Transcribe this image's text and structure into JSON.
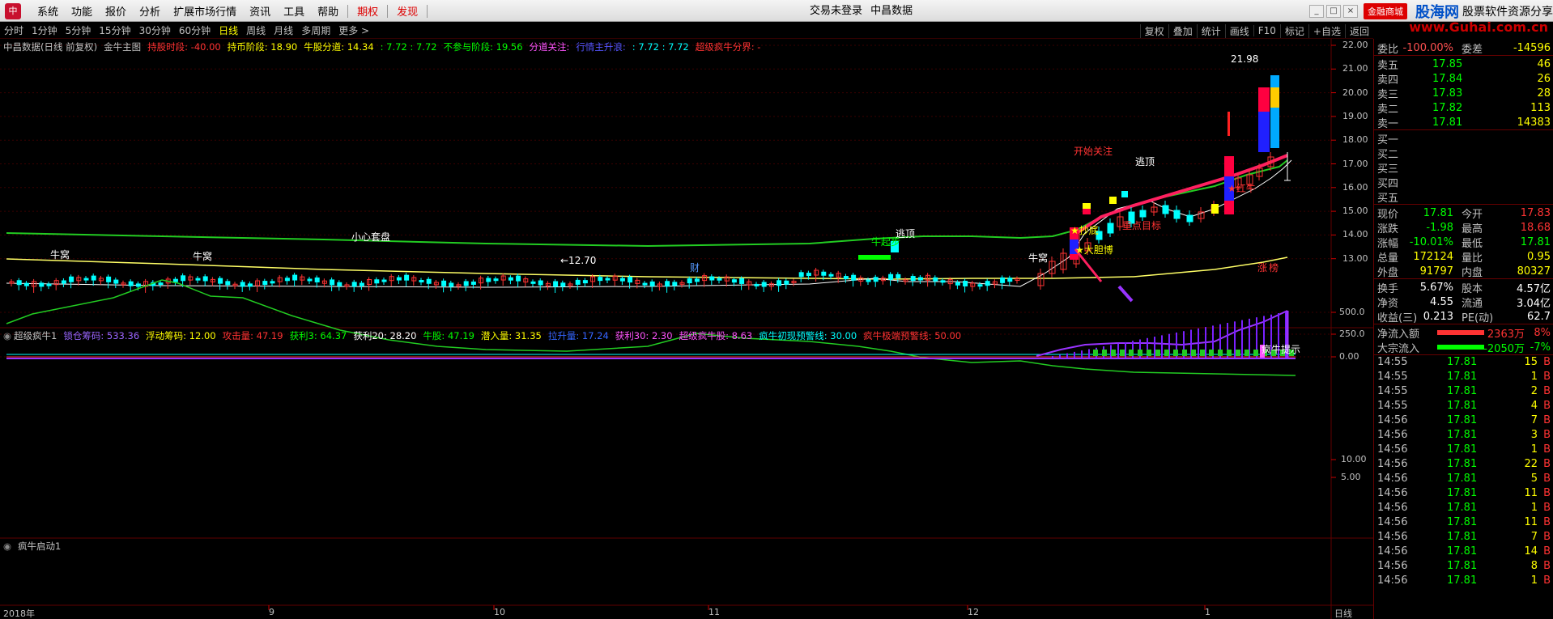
{
  "menubar": {
    "items": [
      "系统",
      "功能",
      "报价",
      "分析",
      "扩展市场行情",
      "资讯",
      "工具",
      "帮助"
    ],
    "special": [
      "期权",
      "发现"
    ],
    "center": [
      "交易未登录",
      "中昌数据"
    ],
    "mall": "金融商城",
    "brand": "股海网",
    "brand2": "股票软件资源分享",
    "brand_url": "www.Guhai.com.cn"
  },
  "toolbar": {
    "timeframes": [
      "分时",
      "1分钟",
      "5分钟",
      "15分钟",
      "30分钟",
      "60分钟",
      "日线",
      "周线",
      "月线",
      "多周期",
      "更多 >"
    ],
    "active": "日线",
    "right": [
      "复权",
      "叠加",
      "统计",
      "画线",
      "F10",
      "标记",
      "+自选",
      "返回"
    ]
  },
  "main_chart": {
    "title_items": [
      {
        "t": "中昌数据(日线 前复权)",
        "c": "#c0c0c0"
      },
      {
        "t": "金牛主图",
        "c": "#c0c0c0"
      },
      {
        "t": "持股时段: -40.00",
        "c": "#ff3333"
      },
      {
        "t": "持币阶段: 18.90",
        "c": "#ffff00"
      },
      {
        "t": "牛股分道: 14.34",
        "c": "#ffff00"
      },
      {
        "t": ": 7.72 : 7.72",
        "c": "#00ff00"
      },
      {
        "t": "不参与阶段: 19.56",
        "c": "#00ff00"
      },
      {
        "t": "分道关注:",
        "c": "#ff55ff"
      },
      {
        "t": "行情主升浪:",
        "c": "#5555ff"
      },
      {
        "t": ": 7.72 : 7.72",
        "c": "#00ffff"
      },
      {
        "t": "超级疯牛分界: -",
        "c": "#ff3333"
      }
    ],
    "y_ticks": [
      "22.00",
      "21.00",
      "20.00",
      "19.00",
      "18.00",
      "17.00",
      "16.00",
      "15.00",
      "14.00",
      "13.00"
    ],
    "annotations": [
      {
        "t": "21.98",
        "c": "#ffffff"
      },
      {
        "t": "开始关注",
        "c": "#ff3333"
      },
      {
        "t": "逃顶",
        "c": "#ffffff"
      },
      {
        "t": "★红牛",
        "c": "#ff3333"
      },
      {
        "t": "重点目标",
        "c": "#ff3333"
      },
      {
        "t": "★抄底",
        "c": "#ffff00"
      },
      {
        "t": "★大胆博",
        "c": "#ffff00"
      },
      {
        "t": "小心套盘",
        "c": "#ffffff"
      },
      {
        "t": "逃顶",
        "c": "#ffffff"
      },
      {
        "t": "牛起步",
        "c": "#00ff00"
      },
      {
        "t": "牛窝",
        "c": "#ffffff"
      },
      {
        "t": "牛窝",
        "c": "#ffffff"
      },
      {
        "t": "牛窝",
        "c": "#ffffff"
      },
      {
        "t": "←12.70",
        "c": "#ffffff"
      },
      {
        "t": "财",
        "c": "#5599ff"
      },
      {
        "t": "涨",
        "c": "#ff3333"
      },
      {
        "t": "榜",
        "c": "#ff3333"
      }
    ]
  },
  "sub_chart1": {
    "title_items": [
      {
        "t": "超级疯牛1",
        "c": "#c0c0c0"
      },
      {
        "t": "锁仓筹码: 533.36",
        "c": "#9966ff"
      },
      {
        "t": "浮动筹码: 12.00",
        "c": "#ffff00"
      },
      {
        "t": "攻击量: 47.19",
        "c": "#ff3333"
      },
      {
        "t": "获利3: 64.37",
        "c": "#00ff00"
      },
      {
        "t": "获利20: 28.20",
        "c": "#ffffff"
      },
      {
        "t": "牛股: 47.19",
        "c": "#00ff00"
      },
      {
        "t": "潜入量: 31.35",
        "c": "#ffff00"
      },
      {
        "t": "拉升量: 17.24",
        "c": "#3366ff"
      },
      {
        "t": "获利30: 2.30",
        "c": "#ff55ff"
      },
      {
        "t": "超级疯牛股: 8.63",
        "c": "#ff55ff"
      },
      {
        "t": "疯牛初现预警线: 30.00",
        "c": "#00ffff"
      },
      {
        "t": "疯牛极端预警线: 50.00",
        "c": "#ff3333"
      }
    ],
    "y_ticks": [
      "500.0",
      "250.0",
      "0.00"
    ],
    "annotation": "疯牛提示"
  },
  "sub_chart2": {
    "title": "疯牛启动1",
    "y_ticks": [
      "10.00",
      "5.00"
    ]
  },
  "x_axis": [
    "2018年",
    "9",
    "10",
    "11",
    "12",
    "1"
  ],
  "x_period": "日线",
  "quote": {
    "header": [
      {
        "l": "委比",
        "v1": "-100.00%",
        "l2": "委差",
        "v2": "-14596"
      }
    ],
    "sells": [
      {
        "l": "卖五",
        "p": "17.85",
        "n": "46"
      },
      {
        "l": "卖四",
        "p": "17.84",
        "n": "26"
      },
      {
        "l": "卖三",
        "p": "17.83",
        "n": "28"
      },
      {
        "l": "卖二",
        "p": "17.82",
        "n": "113"
      },
      {
        "l": "卖一",
        "p": "17.81",
        "n": "14383"
      }
    ],
    "buys": [
      "买一",
      "买二",
      "买三",
      "买四",
      "买五"
    ],
    "stats": [
      {
        "l": "现价",
        "v1": "17.81",
        "l2": "今开",
        "v2": "17.83"
      },
      {
        "l": "涨跌",
        "v1": "-1.98",
        "l2": "最高",
        "v2": "18.68"
      },
      {
        "l": "涨幅",
        "v1": "-10.01%",
        "l2": "最低",
        "v2": "17.81"
      },
      {
        "l": "总量",
        "v1": "172124",
        "l2": "量比",
        "v2": "0.95"
      },
      {
        "l": "外盘",
        "v1": "91797",
        "l2": "内盘",
        "v2": "80327"
      }
    ],
    "stats2": [
      {
        "l": "换手",
        "v1": "5.67%",
        "l2": "股本",
        "v2": "4.57亿"
      },
      {
        "l": "净资",
        "v1": "4.55",
        "l2": "流通",
        "v2": "3.04亿"
      },
      {
        "l": "收益(三)",
        "v1": "0.213",
        "l2": "PE(动)",
        "v2": "62.7"
      }
    ],
    "flows": [
      {
        "l": "净流入额",
        "v": "2363万",
        "p": "8%",
        "c": "#ff3333"
      },
      {
        "l": "大宗流入",
        "v": "-2050万",
        "p": "-7%",
        "c": "#00ff00"
      }
    ],
    "ticks": [
      {
        "t": "14:55",
        "p": "17.81",
        "n": "15",
        "s": "B"
      },
      {
        "t": "14:55",
        "p": "17.81",
        "n": "1",
        "s": "B"
      },
      {
        "t": "14:55",
        "p": "17.81",
        "n": "2",
        "s": "B"
      },
      {
        "t": "14:55",
        "p": "17.81",
        "n": "4",
        "s": "B"
      },
      {
        "t": "14:56",
        "p": "17.81",
        "n": "7",
        "s": "B"
      },
      {
        "t": "14:56",
        "p": "17.81",
        "n": "3",
        "s": "B"
      },
      {
        "t": "14:56",
        "p": "17.81",
        "n": "1",
        "s": "B"
      },
      {
        "t": "14:56",
        "p": "17.81",
        "n": "22",
        "s": "B"
      },
      {
        "t": "14:56",
        "p": "17.81",
        "n": "5",
        "s": "B"
      },
      {
        "t": "14:56",
        "p": "17.81",
        "n": "11",
        "s": "B"
      },
      {
        "t": "14:56",
        "p": "17.81",
        "n": "1",
        "s": "B"
      },
      {
        "t": "14:56",
        "p": "17.81",
        "n": "11",
        "s": "B"
      },
      {
        "t": "14:56",
        "p": "17.81",
        "n": "7",
        "s": "B"
      },
      {
        "t": "14:56",
        "p": "17.81",
        "n": "14",
        "s": "B"
      },
      {
        "t": "14:56",
        "p": "17.81",
        "n": "8",
        "s": "B"
      },
      {
        "t": "14:56",
        "p": "17.81",
        "n": "1",
        "s": "B"
      }
    ]
  },
  "colors": {
    "up": "#ff3333",
    "down": "#00ffff",
    "ma_green": "#22cc22",
    "ma_yellow": "#ffff66",
    "ma_pink": "#ff2060",
    "grid": "#600000"
  }
}
